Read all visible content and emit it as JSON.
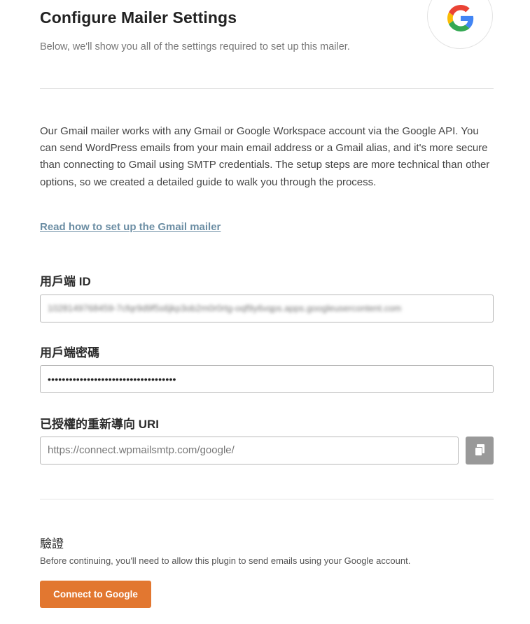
{
  "header": {
    "title": "Configure Mailer Settings",
    "subtitle": "Below, we'll show you all of the settings required to set up this mailer.",
    "logo_icon": "google-g-icon"
  },
  "intro": {
    "text": "Our Gmail mailer works with any Gmail or Google Workspace account via the Google API. You can send WordPress emails from your main email address or a Gmail alias, and it's more secure than connecting to Gmail using SMTP credentials. The setup steps are more technical than other options, so we created a detailed guide to walk you through the process.",
    "link_label": "Read how to set up the Gmail mailer"
  },
  "fields": {
    "client_id": {
      "label": "用戶端 ID",
      "value": "1028149768459-7cfqr9d9f5s6jkp3ob2m0r0rtg-oqf9y6vqps.apps.googleusercontent.com"
    },
    "client_secret": {
      "label": "用戶端密碼",
      "value": "••••••••••••••••••••••••••••••••••••"
    },
    "redirect_uri": {
      "label": "已授權的重新導向 URI",
      "value": "https://connect.wpmailsmtp.com/google/",
      "copy_icon": "copy-icon"
    }
  },
  "authorization": {
    "title": "驗證",
    "description": "Before continuing, you'll need to allow this plugin to send emails using your Google account.",
    "button_label": "Connect to Google"
  },
  "colors": {
    "accent_button": "#e27730",
    "link": "#6c8ea4",
    "copy_button": "#999999"
  }
}
